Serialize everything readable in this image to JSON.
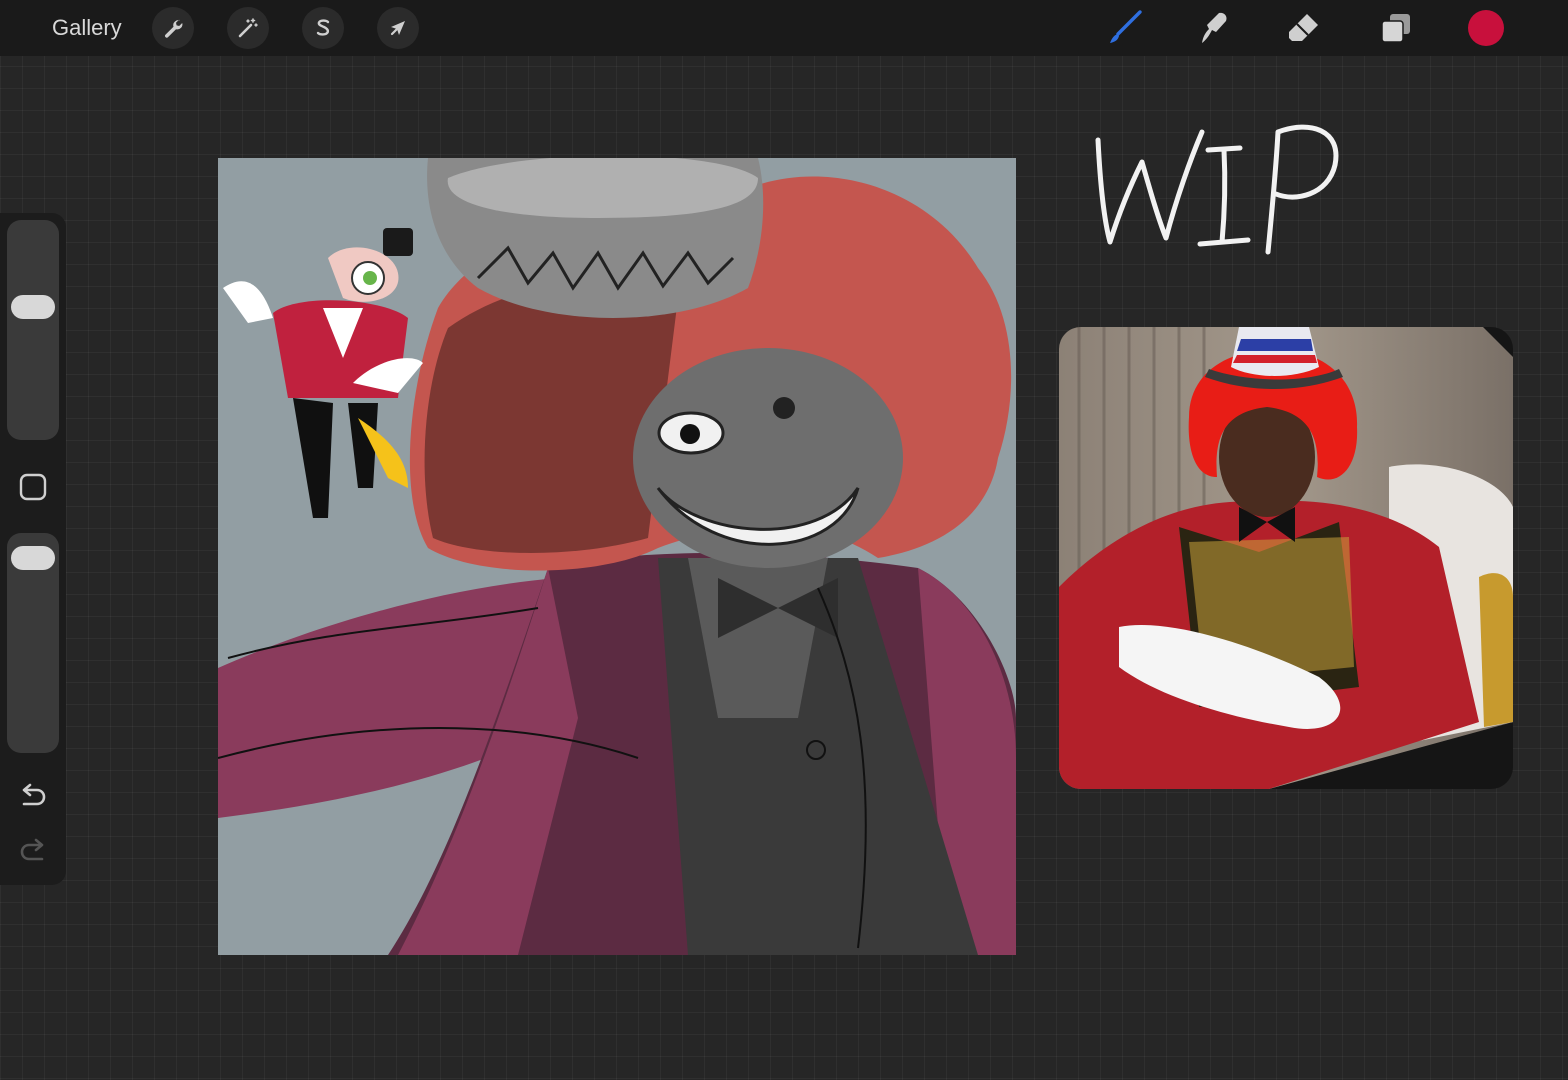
{
  "app": {
    "gallery_label": "Gallery"
  },
  "toolbar_left": {
    "icons": [
      "wrench-icon",
      "magic-wand-icon",
      "selection-s-icon",
      "transform-arrow-icon"
    ]
  },
  "toolbar_right": {
    "icons": [
      "brush-icon",
      "smudge-icon",
      "eraser-icon",
      "layers-icon"
    ],
    "active_tool": "brush",
    "color": "#c8103c"
  },
  "sidebar": {
    "brush_size_level": 0.62,
    "opacity_level": 0.95,
    "icons": [
      "modify-square-icon",
      "undo-icon",
      "redo-icon"
    ]
  },
  "canvas": {
    "annotation": "WIP",
    "background_color": "#929ea3"
  },
  "colors": {
    "topbar": "#1a1a1a",
    "workspace": "#262626",
    "brush_active": "#2f6fe0",
    "hair": "#c4564f",
    "coat": "#8a3b5c"
  }
}
